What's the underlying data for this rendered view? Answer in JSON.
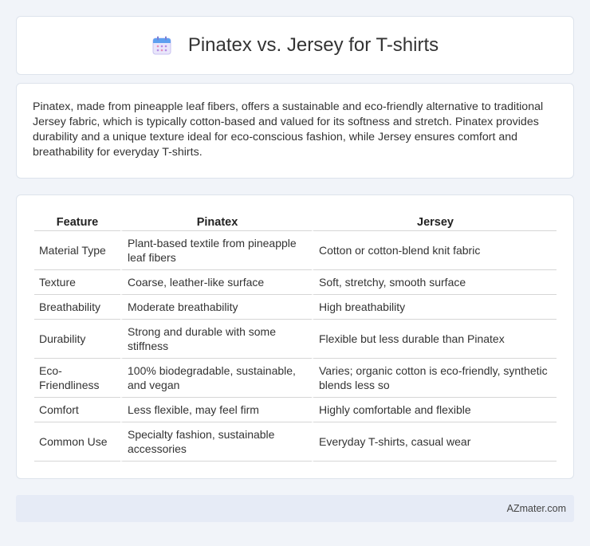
{
  "header": {
    "title": "Pinatex vs. Jersey for T-shirts",
    "icon": "calendar-icon"
  },
  "intro": {
    "text": "Pinatex, made from pineapple leaf fibers, offers a sustainable and eco-friendly alternative to traditional Jersey fabric, which is typically cotton-based and valued for its softness and stretch. Pinatex provides durability and a unique texture ideal for eco-conscious fashion, while Jersey ensures comfort and breathability for everyday T-shirts."
  },
  "table": {
    "headers": [
      "Feature",
      "Pinatex",
      "Jersey"
    ],
    "rows": [
      [
        "Material Type",
        "Plant-based textile from pineapple leaf fibers",
        "Cotton or cotton-blend knit fabric"
      ],
      [
        "Texture",
        "Coarse, leather-like surface",
        "Soft, stretchy, smooth surface"
      ],
      [
        "Breathability",
        "Moderate breathability",
        "High breathability"
      ],
      [
        "Durability",
        "Strong and durable with some stiffness",
        "Flexible but less durable than Pinatex"
      ],
      [
        "Eco-Friendliness",
        "100% biodegradable, sustainable, and vegan",
        "Varies; organic cotton is eco-friendly, synthetic blends less so"
      ],
      [
        "Comfort",
        "Less flexible, may feel firm",
        "Highly comfortable and flexible"
      ],
      [
        "Common Use",
        "Specialty fashion, sustainable accessories",
        "Everyday T-shirts, casual wear"
      ]
    ]
  },
  "footer": {
    "text": "AZmater.com"
  },
  "colors": {
    "background": "#f1f4f9",
    "card": "#ffffff",
    "footer": "#e6ebf6",
    "icon_accent": "#6f8ff0"
  }
}
